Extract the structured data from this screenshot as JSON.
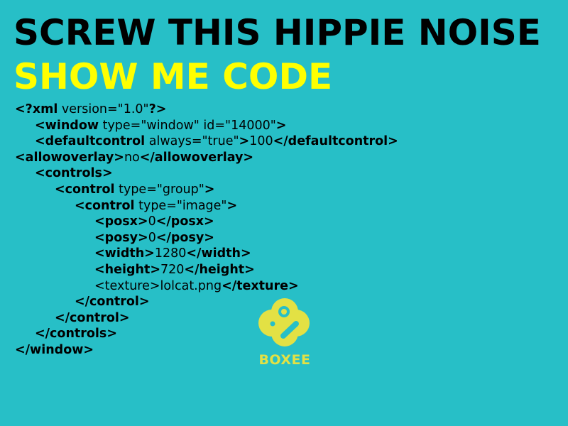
{
  "headline": {
    "line1": "SCREW THIS HIPPIE NOISE",
    "line2": "SHOW ME CODE"
  },
  "code": {
    "l1_open": "<?xml",
    "l1_attr": " version=\"1.0\"",
    "l1_close": "?>",
    "l2_open": "<window",
    "l2_attr": " type=\"window\" id=\"14000\"",
    "l2_close": ">",
    "l3_open": "<defaultcontrol",
    "l3_attr": " always=\"true\"",
    "l3_gt": ">",
    "l3_val": "100",
    "l3_end": "</defaultcontrol>",
    "l4_open": "<allowoverlay>",
    "l4_val": "no",
    "l4_end": "</allowoverlay>",
    "l5": "<controls>",
    "l6_open": "<control",
    "l6_attr": " type=\"group\"",
    "l6_close": ">",
    "l7_open": "<control",
    "l7_attr": " type=\"image\"",
    "l7_close": ">",
    "l8_open": "<posx>",
    "l8_val": "0",
    "l8_end": "</posx>",
    "l9_open": "<posy>",
    "l9_val": "0",
    "l9_end": "</posy>",
    "l10_open": "<width>",
    "l10_val": "1280",
    "l10_end": "</width>",
    "l11_open": "<height>",
    "l11_val": "720",
    "l11_end": "</height>",
    "l12_open": "<texture>",
    "l12_val": "lolcat.png",
    "l12_end": "</texture>",
    "l13": "</control>",
    "l14": "</control>",
    "l15": "</controls>",
    "l16": "</window>"
  },
  "logo": {
    "icon": "boxee-logo-icon",
    "wordmark": "BOXEE",
    "color": "#e3e144"
  },
  "colors": {
    "background": "#27bfc7",
    "headline1": "#000000",
    "headline2": "#ffff00"
  }
}
